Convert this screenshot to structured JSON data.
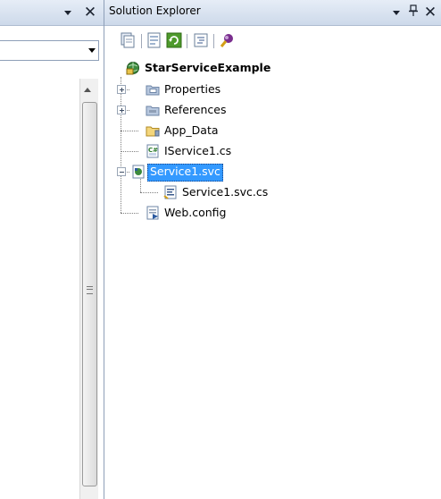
{
  "left_pane": {
    "dropdown_glyph": "▾",
    "close_glyph": "✕"
  },
  "solution_explorer": {
    "title": "Solution Explorer",
    "dropdown_glyph": "▾",
    "pin_glyph": "ꟼ",
    "close_glyph": "✕",
    "toolbar": [
      {
        "name": "show-all-files",
        "icon": "show-all-files-icon"
      },
      {
        "name": "properties",
        "icon": "properties-icon"
      },
      {
        "name": "refresh",
        "icon": "refresh-icon"
      },
      {
        "name": "view-code",
        "icon": "view-code-icon"
      },
      {
        "name": "view-class-diagram",
        "icon": "class-diagram-icon"
      }
    ],
    "tree": {
      "project": "StarServiceExample",
      "items": [
        {
          "label": "Properties",
          "icon": "properties-folder-icon",
          "expandable": true
        },
        {
          "label": "References",
          "icon": "references-folder-icon",
          "expandable": true
        },
        {
          "label": "App_Data",
          "icon": "folder-icon"
        },
        {
          "label": "IService1.cs",
          "icon": "csharp-file-icon"
        },
        {
          "label": "Service1.svc",
          "icon": "svc-file-icon",
          "expanded": true,
          "selected": true
        },
        {
          "label": "Service1.svc.cs",
          "icon": "csharp-code-file-icon",
          "child": true
        },
        {
          "label": "Web.config",
          "icon": "config-file-icon"
        }
      ]
    }
  },
  "colors": {
    "selection": "#3399ff",
    "title_bar_top": "#e6edf7",
    "title_bar_bottom": "#cdd9ea"
  }
}
